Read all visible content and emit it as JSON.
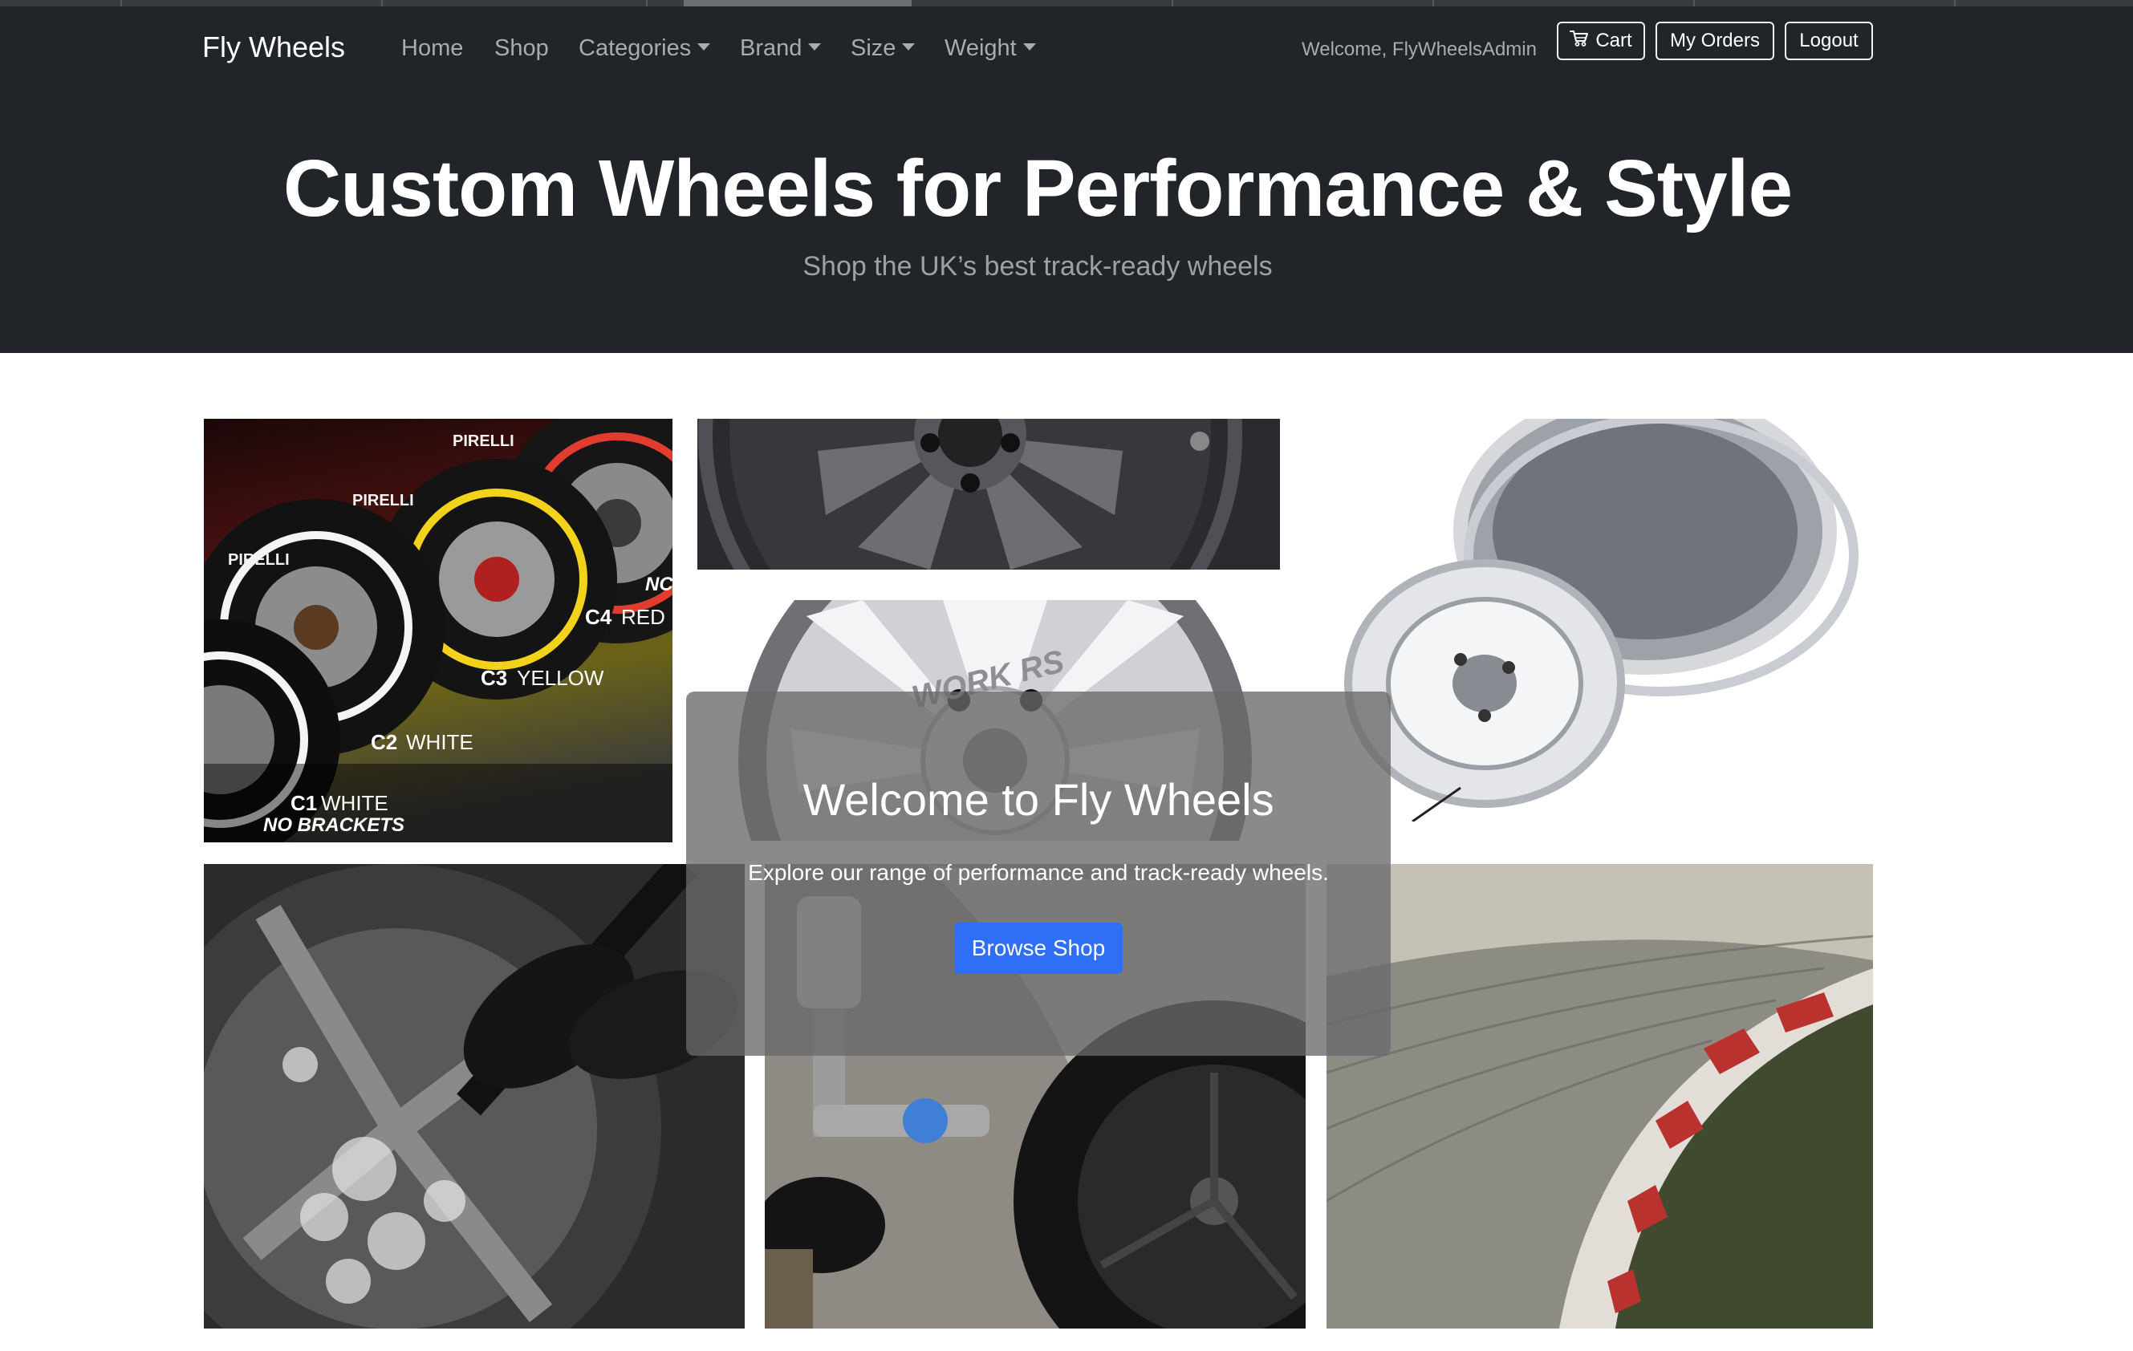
{
  "navbar": {
    "brand": "Fly Wheels",
    "links": {
      "home": "Home",
      "shop": "Shop",
      "categories": "Categories",
      "brand": "Brand",
      "size": "Size",
      "weight": "Weight"
    },
    "welcome": "Welcome, FlyWheelsAdmin",
    "cart": "Cart",
    "my_orders": "My Orders",
    "logout": "Logout"
  },
  "hero": {
    "title": "Custom Wheels for Performance & Style",
    "subtitle": "Shop the UK’s best track-ready wheels"
  },
  "gallery": {
    "tyres_labels": {
      "c4": "C4",
      "c4_color": "RED",
      "c3": "C3",
      "c3_color": "YELLOW",
      "c2": "C2",
      "c2_color": "WHITE",
      "c1": "C1",
      "c1_color": "WHITE",
      "no_brackets": "NO BRACKETS",
      "brand": "PIRELLI",
      "edge_text": "NC"
    },
    "work_wheel_text": "WORK RS"
  },
  "overlay": {
    "title": "Welcome to Fly Wheels",
    "text": "Explore our range of performance and track-ready wheels.",
    "button": "Browse Shop"
  },
  "colors": {
    "navbar_bg": "#212529",
    "primary_button": "#2f6ef6",
    "tyre_red": "#e23b30",
    "tyre_yellow": "#f2d21a"
  }
}
